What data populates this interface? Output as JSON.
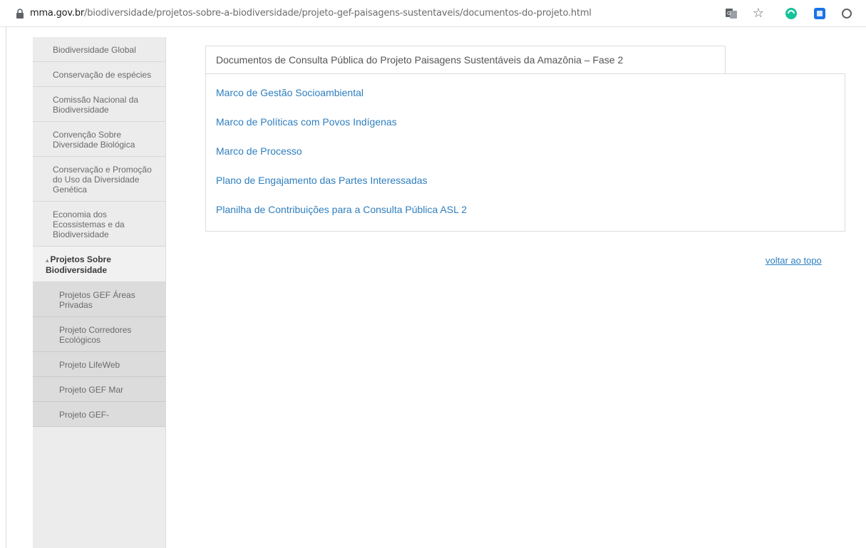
{
  "browser": {
    "url_host": "mma.gov.br",
    "url_path": "/biodiversidade/projetos-sobre-a-biodiversidade/projeto-gef-paisagens-sustentaveis/documentos-do-projeto.html",
    "icons": [
      "lock-icon",
      "translate-icon",
      "star-icon",
      "green-extension-icon",
      "blue-extension-icon",
      "circle-extension-icon"
    ]
  },
  "sidebar": {
    "items": [
      {
        "label": "Biodiversidade Global"
      },
      {
        "label": "Conservação de espécies"
      },
      {
        "label": "Comissão Nacional da Biodiversidade"
      },
      {
        "label": "Convenção Sobre Diversidade Biológica"
      },
      {
        "label": "Conservação e Promoção do Uso da Diversidade Genética"
      },
      {
        "label": "Economia dos Ecossistemas e da Biodiversidade"
      }
    ],
    "active": {
      "caret": "▴",
      "label": "Projetos Sobre Biodiversidade"
    },
    "subitems": [
      {
        "label": "Projetos GEF Áreas Privadas"
      },
      {
        "label": "Projeto Corredores Ecológicos"
      },
      {
        "label": "Projeto LifeWeb"
      },
      {
        "label": "Projeto GEF Mar"
      },
      {
        "label": "Projeto GEF-"
      }
    ]
  },
  "content": {
    "tab_title": "Documentos de Consulta Pública do Projeto Paisagens Sustentáveis da Amazônia – Fase 2",
    "links": [
      {
        "label": "Marco de Gestão Socioambiental"
      },
      {
        "label": "Marco de Políticas com Povos Indígenas"
      },
      {
        "label": "Marco de Processo"
      },
      {
        "label": "Plano de Engajamento das Partes Interessadas"
      },
      {
        "label": "Planilha de Contribuições para a Consulta Pública ASL 2"
      }
    ],
    "back_to_top": "voltar ao topo"
  },
  "colors": {
    "link": "#2f7fbf",
    "sidebar_bg": "#ececec",
    "sidebar_sub_bg": "#dcdcdc"
  }
}
